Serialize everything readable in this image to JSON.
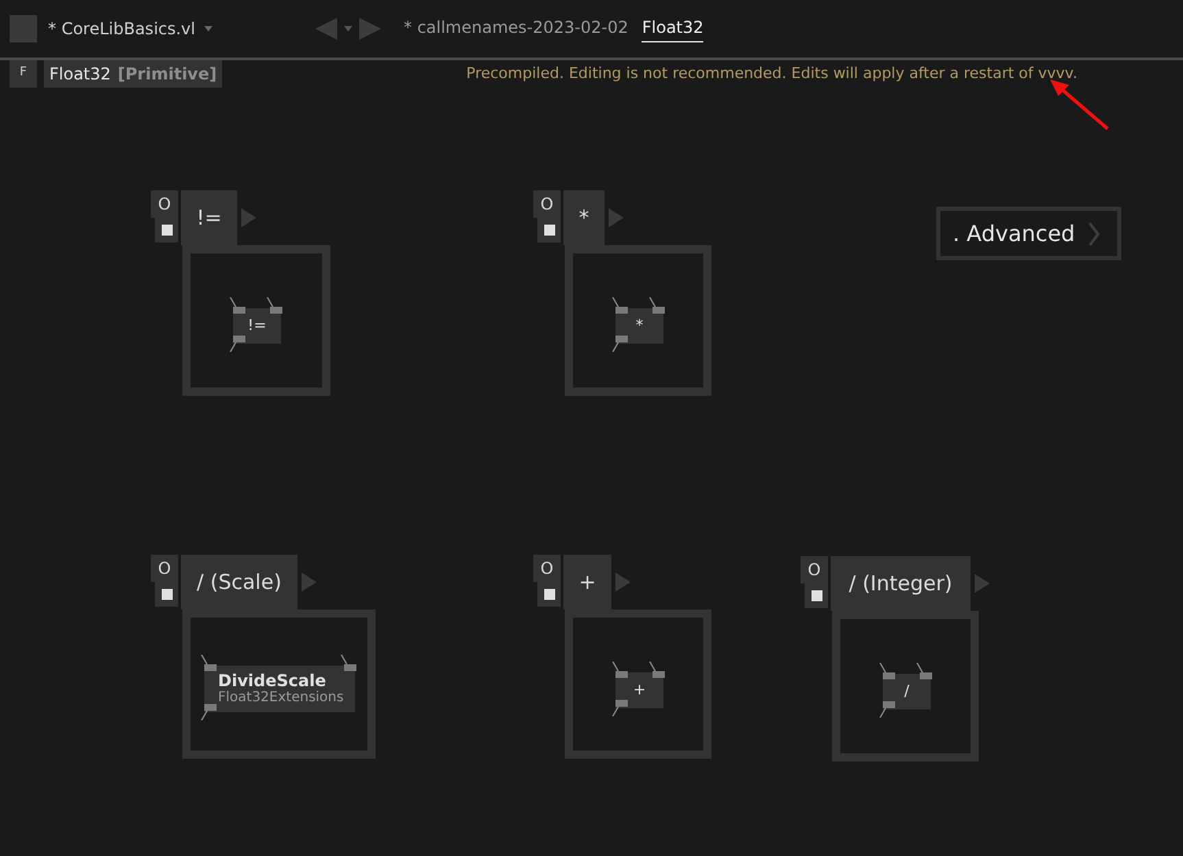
{
  "title_bar": {
    "document": "* CoreLibBasics.vl",
    "tabs": [
      {
        "label": "* callmenames-2023-02-02",
        "selected": false
      },
      {
        "label": "Float32",
        "selected": true
      }
    ]
  },
  "breadcrumb": {
    "badge": "F",
    "name": "Float32",
    "category": "[Primitive]"
  },
  "warning": "Precompiled. Editing is not recommended. Edits will apply after a restart of vvvv.",
  "canvas": {
    "definitions": [
      {
        "badge": "O",
        "title": "!=",
        "node": {
          "name": "!="
        }
      },
      {
        "badge": "O",
        "title": "*",
        "node": {
          "name": "*"
        }
      },
      {
        "badge": "O",
        "title": "/ (Scale)",
        "node": {
          "name": "DivideScale",
          "category": "Float32Extensions"
        }
      },
      {
        "badge": "O",
        "title": "+",
        "node": {
          "name": "+"
        }
      },
      {
        "badge": "O",
        "title": "/ (Integer)",
        "node": {
          "name": "/"
        }
      }
    ],
    "advanced": ". Advanced"
  }
}
